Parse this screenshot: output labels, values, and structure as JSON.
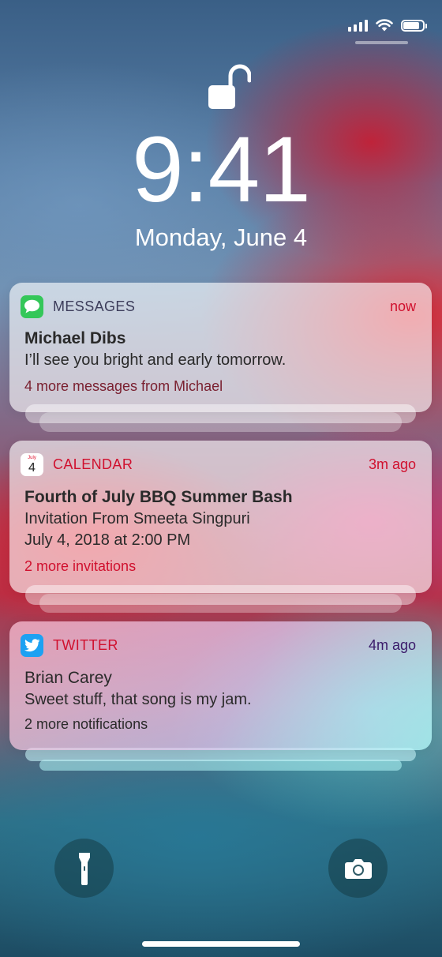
{
  "status_bar": {
    "signal_bars": 4,
    "battery_level": 0.9
  },
  "lock": {
    "icon": "unlocked-padlock-icon"
  },
  "clock": {
    "time": "9:41",
    "date": "Monday, June 4"
  },
  "notifications": [
    {
      "app": "MESSAGES",
      "icon": "messages-icon",
      "when": "now",
      "title": "Michael Dibs",
      "lines": [
        "I’ll see you bright and early tomorrow."
      ],
      "more": "4 more messages from Michael"
    },
    {
      "app": "CALENDAR",
      "icon": "calendar-icon",
      "icon_month": "July",
      "icon_day": "4",
      "when": "3m ago",
      "title": "Fourth of July BBQ Summer Bash",
      "lines": [
        "Invitation From Smeeta Singpuri",
        "July 4, 2018 at 2:00 PM"
      ],
      "more": "2 more invitations"
    },
    {
      "app": "TWITTER",
      "icon": "twitter-icon",
      "when": "4m ago",
      "title": "Brian Carey",
      "lines": [
        "Sweet stuff, that song is my jam."
      ],
      "more": "2 more notifications"
    }
  ],
  "bottom_controls": {
    "left": "flashlight-icon",
    "right": "camera-icon"
  },
  "colors": {
    "messages_icon": "#34c759",
    "twitter_icon": "#1da1f2",
    "messages_header": "#3c3c5a",
    "red_text": "#d0102e",
    "twitter_time": "#3a1a6a"
  }
}
